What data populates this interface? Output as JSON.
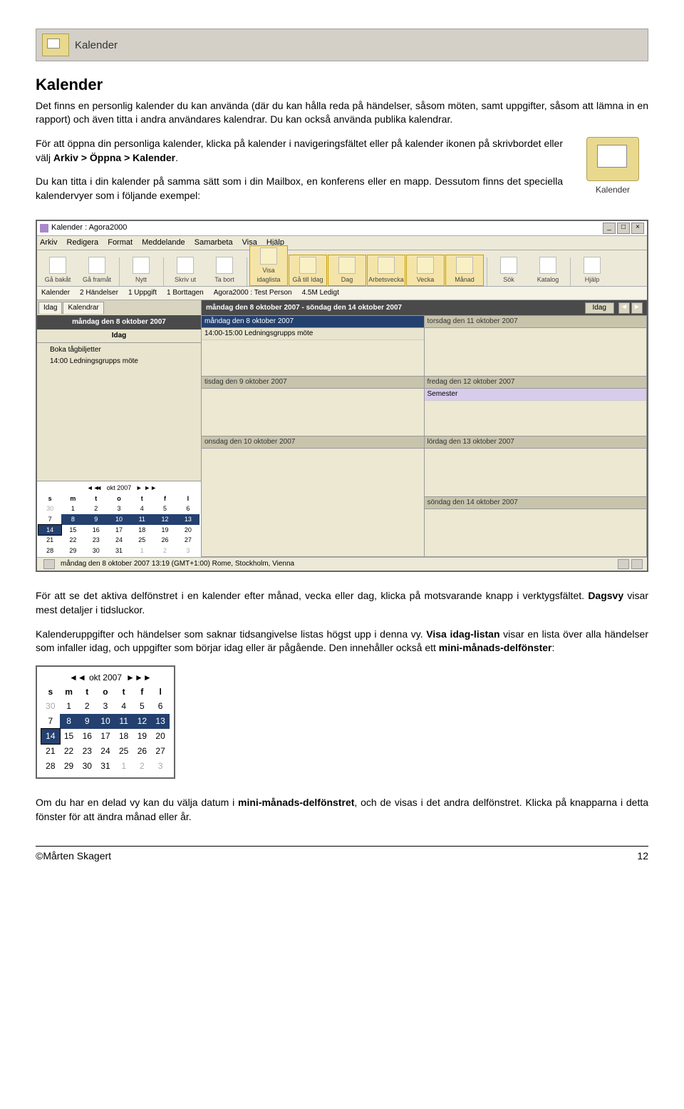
{
  "header": {
    "title": "Kalender"
  },
  "doc": {
    "h1": "Kalender",
    "p1": "Det finns en personlig kalender du kan använda (där du kan hålla reda på händelser, såsom möten, samt uppgifter, såsom att lämna in en rapport) och även titta i andra användares kalendrar. Du kan också använda publika kalendrar.",
    "p2a": "För att öppna din personliga kalender, klicka på kalender i navigeringsfältet eller på kalender ikonen på skrivbordet eller välj ",
    "p2b": "Arkiv > Öppna > Kalender",
    "p2c": ".",
    "p3": "Du kan titta i din kalender på samma sätt som i din Mailbox, en konferens eller en mapp. Dessutom finns det speciella kalendervyer som i följande exempel:",
    "p4a": "För att se det aktiva delfönstret i en kalender efter månad, vecka eller dag, klicka på motsvarande knapp i verktygsfältet. ",
    "p4b": "Dagsvy",
    "p4c": " visar mest detaljer i tidsluckor.",
    "p5a": "Kalenderuppgifter och händelser som saknar tidsangivelse listas högst upp i denna vy. ",
    "p5b": "Visa idag-listan",
    "p5c": " visar en lista över alla händelser som infaller idag, och uppgifter som börjar idag eller är pågående. Den innehåller också ett ",
    "p5d": "mini-månads-delfönster",
    "p5e": ":",
    "p6a": "Om du har en delad vy kan du välja datum i ",
    "p6b": "mini-månads-delfönstret",
    "p6c": ", och de visas i det andra delfönstret. Klicka på knapparna i detta fönster för att ändra månad eller år.",
    "kal_icon_label": "Kalender"
  },
  "app": {
    "title": "Kalender : Agora2000",
    "menus": [
      "Arkiv",
      "Redigera",
      "Format",
      "Meddelande",
      "Samarbeta",
      "Visa",
      "Hjälp"
    ],
    "toolbar": [
      {
        "label": "Gå bakåt"
      },
      {
        "label": "Gå framåt"
      },
      {
        "label": "Nytt"
      },
      {
        "label": "Skriv ut"
      },
      {
        "label": "Ta bort"
      },
      {
        "label": "Visa idaglista",
        "hl": true
      },
      {
        "label": "Gå till Idag",
        "hl": true
      },
      {
        "label": "Dag",
        "hl": true
      },
      {
        "label": "Arbetsvecka",
        "hl": true
      },
      {
        "label": "Vecka",
        "hl": true
      },
      {
        "label": "Månad",
        "hl": true
      },
      {
        "label": "Sök"
      },
      {
        "label": "Katalog"
      },
      {
        "label": "Hjälp"
      }
    ],
    "path": {
      "p1": "Kalender",
      "p2": "2 Händelser",
      "p3": "1 Uppgift",
      "p4": "1 Borttagen",
      "p5": "Agora2000 : Test Person",
      "p6": "4.5M Ledigt"
    },
    "left": {
      "tab1": "Idag",
      "tab2": "Kalendrar",
      "dayhdr": "måndag den 8 oktober 2007",
      "idag_label": "Idag",
      "items": [
        "Boka tågbiljetter",
        "14:00 Ledningsgrupps möte"
      ]
    },
    "range": {
      "text": "måndag den 8 oktober 2007 - söndag den 14 oktober 2007",
      "idag": "Idag"
    },
    "days": {
      "d0": "måndag den 8 oktober 2007",
      "d0e": "14:00-15:00 Ledningsgrupps möte",
      "d1": "torsdag den 11 oktober 2007",
      "d2": "tisdag den 9 oktober 2007",
      "d3": "fredag den 12 oktober 2007",
      "d3e": "Semester",
      "d4": "onsdag den 10 oktober 2007",
      "d5": "lördag den 13 oktober 2007",
      "d6": "söndag den 14 oktober 2007"
    },
    "status": "måndag den 8 oktober 2007 13:19 (GMT+1:00) Rome, Stockholm, Vienna"
  },
  "minical": {
    "month": "okt 2007",
    "dow": [
      "s",
      "m",
      "t",
      "o",
      "t",
      "f",
      "l"
    ],
    "rows": [
      [
        "30",
        "1",
        "2",
        "3",
        "4",
        "5",
        "6"
      ],
      [
        "7",
        "8",
        "9",
        "10",
        "11",
        "12",
        "13"
      ],
      [
        "14",
        "15",
        "16",
        "17",
        "18",
        "19",
        "20"
      ],
      [
        "21",
        "22",
        "23",
        "24",
        "25",
        "26",
        "27"
      ],
      [
        "28",
        "29",
        "30",
        "31",
        "1",
        "2",
        "3"
      ]
    ]
  },
  "footer": {
    "author": "©Mårten Skagert",
    "page": "12"
  }
}
